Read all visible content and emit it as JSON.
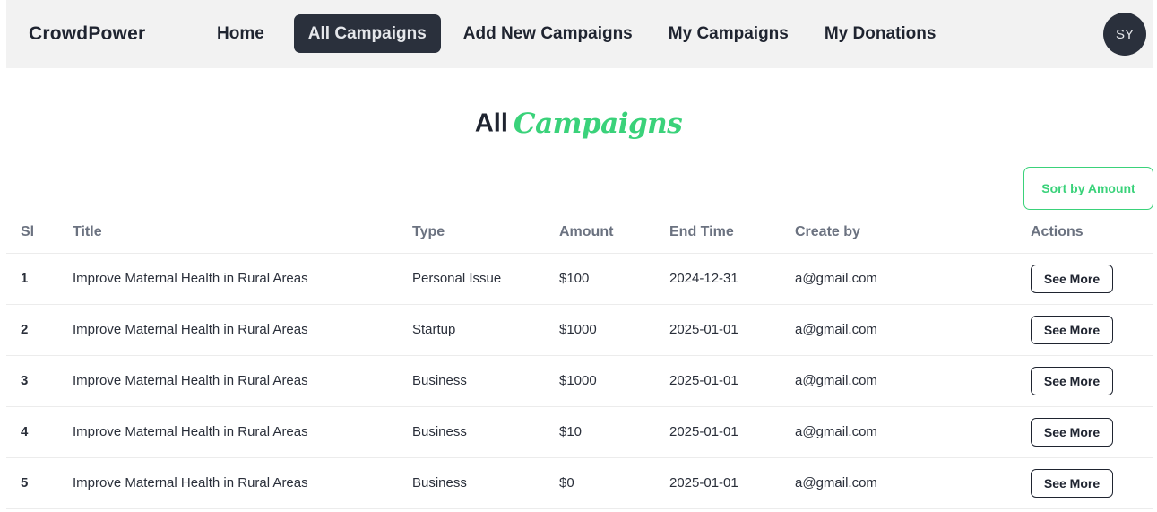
{
  "navbar": {
    "brand": "CrowdPower",
    "links": [
      {
        "label": "Home",
        "active": false
      },
      {
        "label": "All Campaigns",
        "active": true
      },
      {
        "label": "Add New Campaigns",
        "active": false
      },
      {
        "label": "My Campaigns",
        "active": false
      },
      {
        "label": "My Donations",
        "active": false
      }
    ],
    "avatar_initials": "SY"
  },
  "heading": {
    "main": "All",
    "accent": "Campaigns"
  },
  "sort_button_label": "Sort by Amount",
  "table": {
    "headers": {
      "sl": "Sl",
      "title": "Title",
      "type": "Type",
      "amount": "Amount",
      "end_time": "End Time",
      "create_by": "Create by",
      "actions": "Actions"
    },
    "rows": [
      {
        "sl": "1",
        "title": "Improve Maternal Health in Rural Areas",
        "type": "Personal Issue",
        "amount": "$100",
        "end_time": "2024-12-31",
        "create_by": "a@gmail.com",
        "action_label": "See More"
      },
      {
        "sl": "2",
        "title": "Improve Maternal Health in Rural Areas",
        "type": "Startup",
        "amount": "$1000",
        "end_time": "2025-01-01",
        "create_by": "a@gmail.com",
        "action_label": "See More"
      },
      {
        "sl": "3",
        "title": "Improve Maternal Health in Rural Areas",
        "type": "Business",
        "amount": "$1000",
        "end_time": "2025-01-01",
        "create_by": "a@gmail.com",
        "action_label": "See More"
      },
      {
        "sl": "4",
        "title": "Improve Maternal Health in Rural Areas",
        "type": "Business",
        "amount": "$10",
        "end_time": "2025-01-01",
        "create_by": "a@gmail.com",
        "action_label": "See More"
      },
      {
        "sl": "5",
        "title": "Improve Maternal Health in Rural Areas",
        "type": "Business",
        "amount": "$0",
        "end_time": "2025-01-01",
        "create_by": "a@gmail.com",
        "action_label": "See More"
      }
    ]
  },
  "colors": {
    "accent": "#3ad27a",
    "dark": "#2a303c",
    "navbar_bg": "#f2f2f2"
  }
}
